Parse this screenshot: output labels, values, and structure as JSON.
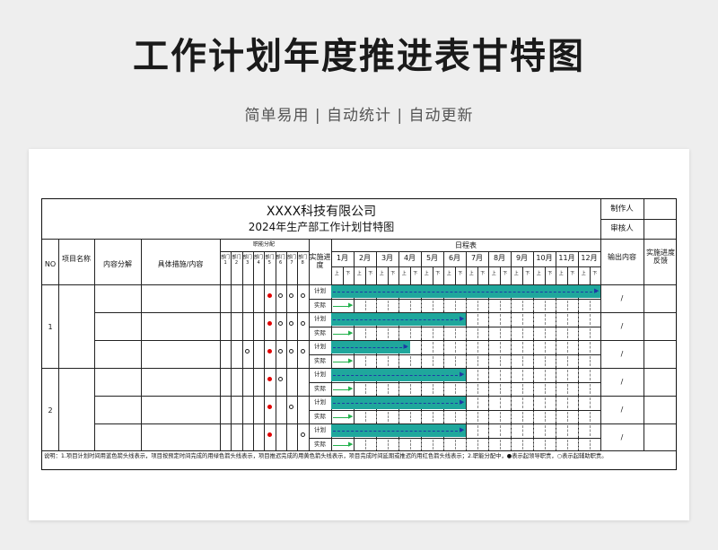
{
  "title": "工作计划年度推进表甘特图",
  "subtitle": "简单易用 | 自动统计 | 自动更新",
  "sheet": {
    "company": "XXXX科技有限公司",
    "chart_title": "2024年生产部工作计划甘特图",
    "maker_label": "制作人",
    "reviewer_label": "审核人",
    "headers": {
      "no": "NO",
      "project": "项目名称",
      "breakdown": "内容分解",
      "measures": "具体措施/内容",
      "duties": "职能分配",
      "progress": "实施进度",
      "schedule": "日程表",
      "output": "输出内容",
      "feedback": "实施进度反馈"
    },
    "dept_labels": [
      "部门1",
      "部门2",
      "部门3",
      "部门4",
      "部门5",
      "部门6",
      "部门7",
      "部门8"
    ],
    "months": [
      "1月",
      "2月",
      "3月",
      "4月",
      "5月",
      "6月",
      "7月",
      "8月",
      "9月",
      "10月",
      "11月",
      "12月"
    ],
    "half_labels": [
      "上",
      "下"
    ],
    "plan_label": "计划",
    "actual_label": "实际",
    "groups": [
      {
        "no": "1"
      },
      {
        "no": "2"
      }
    ],
    "rows": [
      {
        "plan_end": 12,
        "actual_end": 1,
        "marks": [
          "",
          "",
          "",
          "",
          "red",
          "circle",
          "circle",
          "circle"
        ],
        "output": "/"
      },
      {
        "plan_end": 6,
        "actual_end": 1,
        "marks": [
          "",
          "",
          "",
          "",
          "red",
          "circle",
          "circle",
          "circle"
        ],
        "output": "/"
      },
      {
        "plan_end": 3.5,
        "actual_end": 1,
        "marks": [
          "",
          "",
          "circle",
          "",
          "red",
          "circle",
          "circle",
          "circle"
        ],
        "output": "/"
      },
      {
        "plan_end": 6,
        "actual_end": 1,
        "marks": [
          "",
          "",
          "",
          "",
          "red",
          "circle",
          "",
          ""
        ],
        "output": "/"
      },
      {
        "plan_end": 6,
        "actual_end": 1,
        "marks": [
          "",
          "",
          "",
          "",
          "red",
          "",
          "circle",
          ""
        ],
        "output": "/"
      },
      {
        "plan_end": 6,
        "actual_end": 1,
        "marks": [
          "",
          "",
          "",
          "",
          "red",
          "",
          "",
          "circle"
        ],
        "output": "/"
      }
    ],
    "note": "说明：1.项目计划时间用蓝色箭头线表示，项目按预定时间完成的用绿色箭头线表示，项目推迟完成的用黄色箭头线表示，项目完成时间延期或推迟的用红色箭头线表示；2.职能分配中，●表示起领导职责，○表示起辅助职责。"
  }
}
